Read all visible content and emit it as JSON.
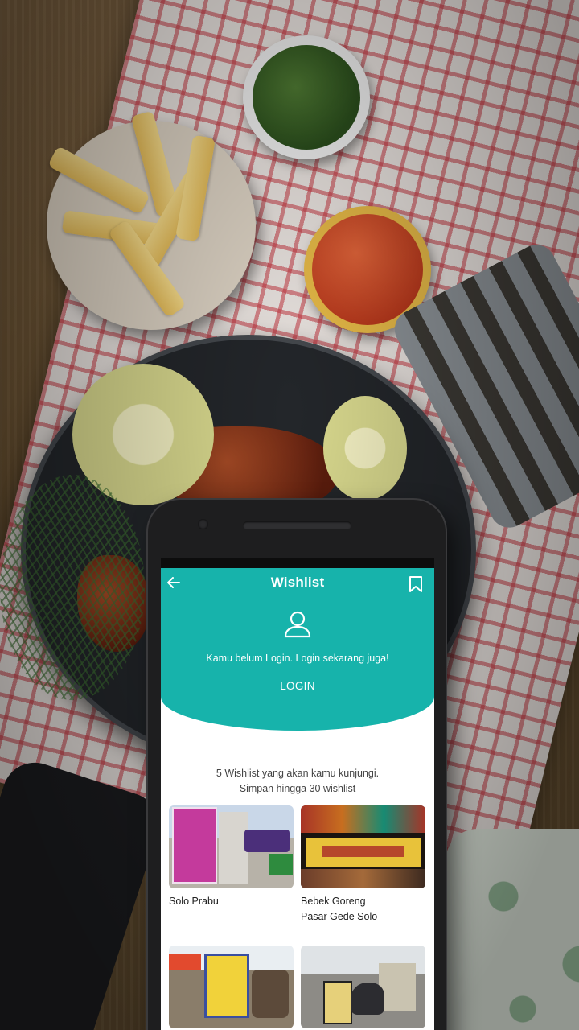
{
  "app": {
    "title": "Wishlist",
    "accent_color": "#17b3ab",
    "back_icon": "arrow-left-icon",
    "bookmark_icon": "bookmark-icon"
  },
  "login_banner": {
    "icon": "user-icon",
    "message": "Kamu belum Login. Login sekarang juga!",
    "button_label": "LOGIN"
  },
  "wishlist_info": {
    "line1": "5 Wishlist yang akan kamu kunjungi.",
    "line2": "Simpan hingga 30 wishlist"
  },
  "items": [
    {
      "name": "Solo Prabu"
    },
    {
      "name": "Bebek Goreng\nPasar Gede Solo"
    },
    {
      "name": ""
    },
    {
      "name": ""
    }
  ]
}
